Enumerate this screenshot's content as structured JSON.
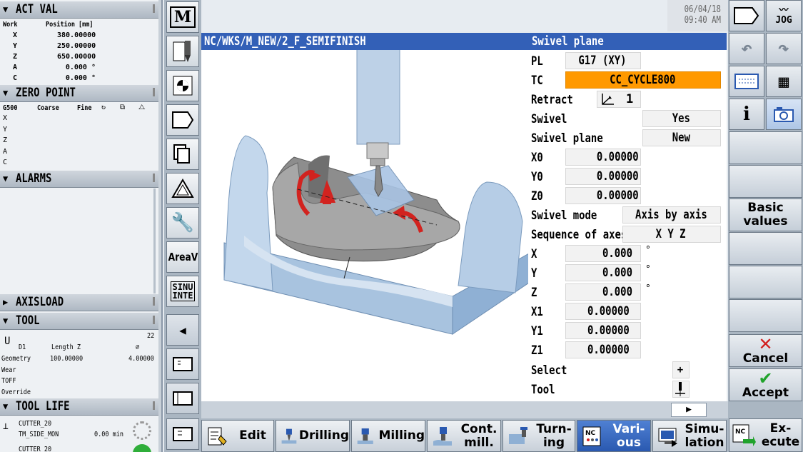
{
  "left_panel": {
    "act_val": {
      "title": "ACT VAL",
      "col_work": "Work",
      "col_pos": "Position [mm]",
      "rows": [
        {
          "axis": "X",
          "value": "380.00000"
        },
        {
          "axis": "Y",
          "value": "250.00000"
        },
        {
          "axis": "Z",
          "value": "650.00000"
        },
        {
          "axis": "A",
          "value": "0.000 °"
        },
        {
          "axis": "C",
          "value": "0.000 °"
        }
      ]
    },
    "zero_point": {
      "title": "ZERO POINT",
      "frame": "G500",
      "col_coarse": "Coarse",
      "col_fine": "Fine",
      "axes": [
        "X",
        "Y",
        "Z",
        "A",
        "C"
      ]
    },
    "alarms": {
      "title": "ALARMS"
    },
    "axisload": {
      "title": "AXISLOAD"
    },
    "tool": {
      "title": "TOOL",
      "number": "22",
      "edge": "D1",
      "length_label": "Length Z",
      "diam_symbol": "⌀",
      "geometry_label": "Geometry",
      "geometry_length": "100.00000",
      "geometry_diam": "4.00000",
      "wear_label": "Wear",
      "toff_label": "TOFF",
      "override_label": "Override"
    },
    "tool_life": {
      "title": "TOOL LIFE",
      "item1_name": "CUTTER_20",
      "item1_sub": "TM_SIDE_MON",
      "item1_time": "0.00 min",
      "item2_name": "CUTTER_20"
    }
  },
  "vstrip": {
    "m_label": "M",
    "area_label": "AreaV",
    "sinu_label": "SINU INTE"
  },
  "header": {
    "date": "06/04/18",
    "time": "09:40 AM",
    "path": "NC/WKS/M_NEW/2_F_SEMIFINISH",
    "form_title": "Swivel plane"
  },
  "form": {
    "pl": {
      "label": "PL",
      "value": "G17 (XY)"
    },
    "tc": {
      "label": "TC",
      "value": "CC_CYCLE800"
    },
    "retract": {
      "label": "Retract",
      "value": "1"
    },
    "swivel": {
      "label": "Swivel",
      "value": "Yes"
    },
    "swivel_plane": {
      "label": "Swivel plane",
      "value": "New"
    },
    "x0": {
      "label": "X0",
      "value": "0.00000"
    },
    "y0": {
      "label": "Y0",
      "value": "0.00000"
    },
    "z0": {
      "label": "Z0",
      "value": "0.00000"
    },
    "swivel_mode": {
      "label": "Swivel mode",
      "value": "Axis by axis"
    },
    "seq": {
      "label": "Sequence of axes",
      "value": "X Y Z"
    },
    "x": {
      "label": "X",
      "value": "0.000",
      "unit": "°"
    },
    "y": {
      "label": "Y",
      "value": "0.000",
      "unit": "°"
    },
    "z": {
      "label": "Z",
      "value": "0.000",
      "unit": "°"
    },
    "x1": {
      "label": "X1",
      "value": "0.00000"
    },
    "y1": {
      "label": "Y1",
      "value": "0.00000"
    },
    "z1": {
      "label": "Z1",
      "value": "0.00000"
    },
    "select": {
      "label": "Select",
      "value": "+"
    },
    "tool": {
      "label": "Tool"
    }
  },
  "right_keys": {
    "jog": "JOG",
    "basic_values": [
      "Basic",
      "values"
    ],
    "cancel": "Cancel",
    "accept": "Accept"
  },
  "bottom_keys": {
    "edit": "Edit",
    "drilling": "Drilling",
    "milling": "Milling",
    "cont_mill": [
      "Cont.",
      "mill."
    ],
    "turning": [
      "Turn-",
      "ing"
    ],
    "various": [
      "Vari-",
      "ous"
    ],
    "simulation": [
      "Simu-",
      "lation"
    ],
    "execute": [
      "Ex-",
      "ecute"
    ],
    "nc_label": "NC"
  },
  "colors": {
    "header_blue": "#3360b7",
    "tc_orange": "#ff9900",
    "selected_key": "#2a59b0"
  }
}
